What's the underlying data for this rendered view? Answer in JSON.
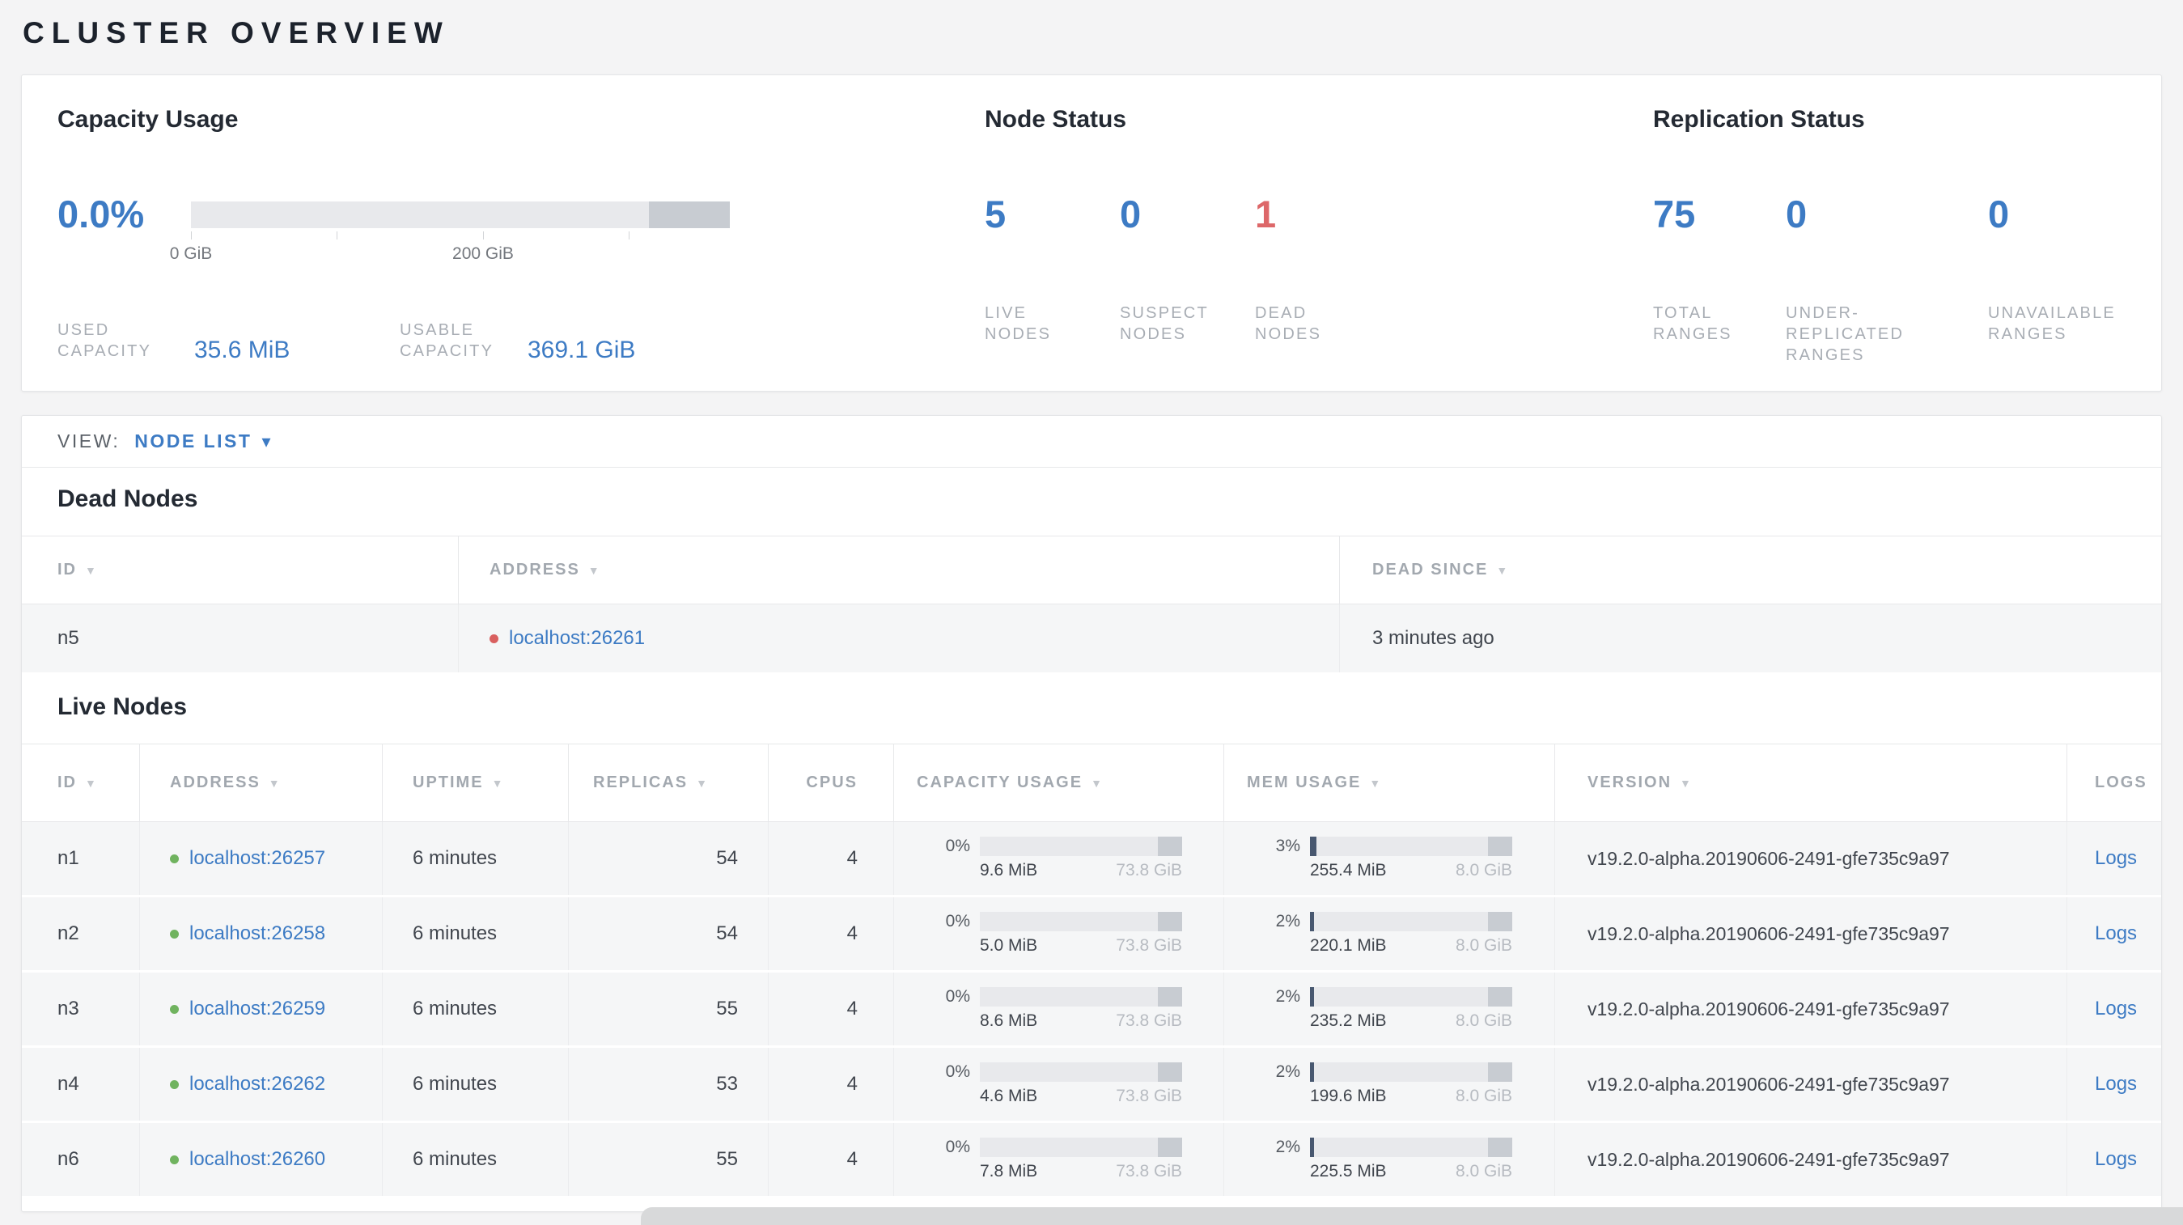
{
  "icons": {
    "sort_desc": "▼",
    "caret_down": "▾"
  },
  "colors": {
    "accent_blue": "#3d7bc4",
    "danger_red": "#dd6769",
    "live_green": "#70b35f"
  },
  "page": {
    "title": "CLUSTER OVERVIEW"
  },
  "summary": {
    "capacity": {
      "title": "Capacity Usage",
      "percent": "0.0%",
      "axis_ticks": [
        "0 GiB",
        "200 GiB"
      ],
      "used": {
        "label": "USED\nCAPACITY",
        "value": "35.6 MiB"
      },
      "usable": {
        "label": "USABLE\nCAPACITY",
        "value": "369.1 GiB"
      }
    },
    "node_status": {
      "title": "Node Status",
      "stats": [
        {
          "value": "5",
          "label": "LIVE\nNODES"
        },
        {
          "value": "0",
          "label": "SUSPECT\nNODES"
        },
        {
          "value": "1",
          "label": "DEAD\nNODES"
        }
      ]
    },
    "replication": {
      "title": "Replication Status",
      "stats": [
        {
          "value": "75",
          "label": "TOTAL\nRANGES"
        },
        {
          "value": "0",
          "label": "UNDER-\nREPLICATED\nRANGES"
        },
        {
          "value": "0",
          "label": "UNAVAILABLE\nRANGES"
        }
      ]
    }
  },
  "view_bar": {
    "label": "VIEW:",
    "selected": "NODE LIST"
  },
  "dead_nodes": {
    "title": "Dead Nodes",
    "columns": [
      "ID",
      "ADDRESS",
      "DEAD SINCE"
    ],
    "rows": [
      {
        "id": "n5",
        "address": "localhost:26261",
        "dead_since": "3 minutes ago"
      }
    ]
  },
  "live_nodes": {
    "title": "Live Nodes",
    "columns": [
      "ID",
      "ADDRESS",
      "UPTIME",
      "REPLICAS",
      "CPUS",
      "CAPACITY USAGE",
      "MEM USAGE",
      "VERSION",
      "LOGS"
    ],
    "rows": [
      {
        "id": "n1",
        "address": "localhost:26257",
        "uptime": "6 minutes",
        "replicas": "54",
        "cpus": "4",
        "capacity": {
          "pct": "0%",
          "used": "9.6 MiB",
          "total": "73.8 GiB"
        },
        "memory": {
          "pct": "3%",
          "used": "255.4 MiB",
          "total": "8.0 GiB"
        },
        "version": "v19.2.0-alpha.20190606-2491-gfe735c9a97",
        "logs_label": "Logs"
      },
      {
        "id": "n2",
        "address": "localhost:26258",
        "uptime": "6 minutes",
        "replicas": "54",
        "cpus": "4",
        "capacity": {
          "pct": "0%",
          "used": "5.0 MiB",
          "total": "73.8 GiB"
        },
        "memory": {
          "pct": "2%",
          "used": "220.1 MiB",
          "total": "8.0 GiB"
        },
        "version": "v19.2.0-alpha.20190606-2491-gfe735c9a97",
        "logs_label": "Logs"
      },
      {
        "id": "n3",
        "address": "localhost:26259",
        "uptime": "6 minutes",
        "replicas": "55",
        "cpus": "4",
        "capacity": {
          "pct": "0%",
          "used": "8.6 MiB",
          "total": "73.8 GiB"
        },
        "memory": {
          "pct": "2%",
          "used": "235.2 MiB",
          "total": "8.0 GiB"
        },
        "version": "v19.2.0-alpha.20190606-2491-gfe735c9a97",
        "logs_label": "Logs"
      },
      {
        "id": "n4",
        "address": "localhost:26262",
        "uptime": "6 minutes",
        "replicas": "53",
        "cpus": "4",
        "capacity": {
          "pct": "0%",
          "used": "4.6 MiB",
          "total": "73.8 GiB"
        },
        "memory": {
          "pct": "2%",
          "used": "199.6 MiB",
          "total": "8.0 GiB"
        },
        "version": "v19.2.0-alpha.20190606-2491-gfe735c9a97",
        "logs_label": "Logs"
      },
      {
        "id": "n6",
        "address": "localhost:26260",
        "uptime": "6 minutes",
        "replicas": "55",
        "cpus": "4",
        "capacity": {
          "pct": "0%",
          "used": "7.8 MiB",
          "total": "73.8 GiB"
        },
        "memory": {
          "pct": "2%",
          "used": "225.5 MiB",
          "total": "8.0 GiB"
        },
        "version": "v19.2.0-alpha.20190606-2491-gfe735c9a97",
        "logs_label": "Logs"
      }
    ]
  }
}
